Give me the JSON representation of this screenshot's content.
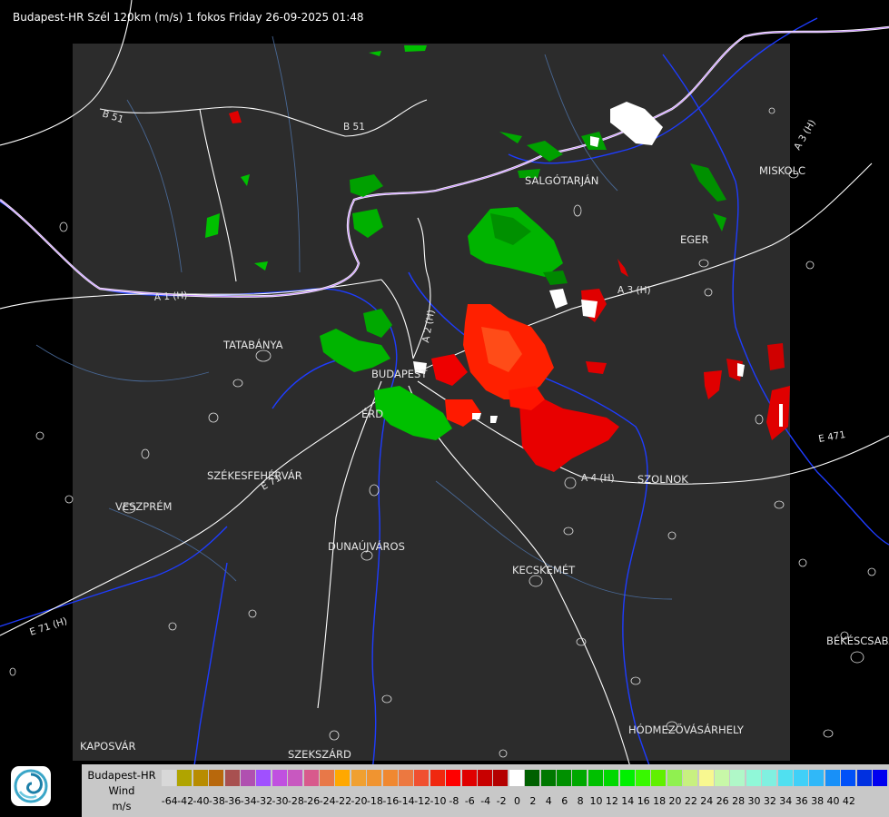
{
  "header": {
    "title": "Budapest-HR Szél 120km (m/s) 1 fokos Friday 26-09-2025 01:48"
  },
  "map": {
    "cities": [
      {
        "id": "tatabanya",
        "label": "TATABÁNYA"
      },
      {
        "id": "budapest",
        "label": "BUDAPEST"
      },
      {
        "id": "erd",
        "label": "ÉRD"
      },
      {
        "id": "szekesfehervar",
        "label": "SZÉKESFEHÉRVÁR"
      },
      {
        "id": "veszprem",
        "label": "VESZPRÉM"
      },
      {
        "id": "dunaujvaros",
        "label": "DUNAÚJVÁROS"
      },
      {
        "id": "kecskemet",
        "label": "KECSKEMÉT"
      },
      {
        "id": "salgotarjan",
        "label": "SALGÓTARJÁN"
      },
      {
        "id": "eger",
        "label": "EGER"
      },
      {
        "id": "miskolc",
        "label": "MISKOLC"
      },
      {
        "id": "szolnok",
        "label": "SZOLNOK"
      },
      {
        "id": "bekescsaba",
        "label": "BÉKÉSCSABA"
      },
      {
        "id": "hodmezovasarhely",
        "label": "HÓDMEZŐVÁSÁRHELY"
      },
      {
        "id": "kaposvar",
        "label": "KAPOSVÁR"
      },
      {
        "id": "szekszard",
        "label": "SZEKSZÁRD"
      }
    ],
    "roads": [
      {
        "id": "b51-west",
        "label": "B 51"
      },
      {
        "id": "b51-east",
        "label": "B 51"
      },
      {
        "id": "a1",
        "label": "A 1 (H)"
      },
      {
        "id": "a2",
        "label": "A 2 (H)"
      },
      {
        "id": "a3",
        "label": "A 3 (H)"
      },
      {
        "id": "a3-ne",
        "label": "A 3 (H)"
      },
      {
        "id": "a4",
        "label": "A 4 (H)"
      },
      {
        "id": "e71",
        "label": "E 71"
      },
      {
        "id": "e71-sw",
        "label": "E 71 (H)"
      },
      {
        "id": "e471",
        "label": "E 471"
      }
    ]
  },
  "legend": {
    "title_line1": "Budapest-HR",
    "title_line2": "Wind",
    "title_line3": "m/s",
    "colors": [
      "#d8d8d8",
      "#b0a400",
      "#b88c00",
      "#b8680c",
      "#a85050",
      "#b050b0",
      "#a050ff",
      "#c050e0",
      "#c858c0",
      "#d85a8c",
      "#e87848",
      "#ffa800",
      "#f0a030",
      "#f09430",
      "#f08830",
      "#ec7840",
      "#f05030",
      "#f02810",
      "#ff0000",
      "#e00000",
      "#c80000",
      "#b40000",
      "#ffffff",
      "#006000",
      "#007800",
      "#009000",
      "#00a800",
      "#00c000",
      "#00d800",
      "#00f000",
      "#38f800",
      "#60f000",
      "#90f050",
      "#c8f080",
      "#f8f890",
      "#c8f8a8",
      "#b0f8c8",
      "#90f8d8",
      "#80f0e0",
      "#50e0f0",
      "#40d0f8",
      "#30b8f8",
      "#1890f8",
      "#0050f8",
      "#0030e0",
      "#0000f0"
    ],
    "ticks": [
      "-64",
      "-42",
      "-40",
      "-38",
      "-36",
      "-34",
      "-32",
      "-30",
      "-28",
      "-26",
      "-24",
      "-22",
      "-20",
      "-18",
      "-16",
      "-14",
      "-12",
      "-10",
      "-8",
      "-6",
      "-4",
      "-2",
      "0",
      "2",
      "4",
      "6",
      "8",
      "10",
      "12",
      "14",
      "16",
      "18",
      "20",
      "22",
      "24",
      "26",
      "28",
      "30",
      "32",
      "34",
      "36",
      "38",
      "40",
      "42"
    ]
  },
  "logo": {
    "icon": "met-service-swirl-icon"
  }
}
